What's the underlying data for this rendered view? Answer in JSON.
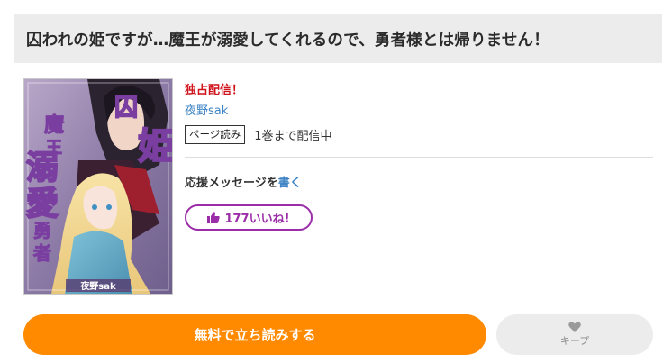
{
  "title": "囚われの姫ですが…魔王が溺愛してくれるので、勇者様とは帰りません！",
  "cover": {
    "title_text": "囚われの姫ですが…魔王が溺愛してくれるので、勇者様とは帰りません！",
    "author_credit": "夜野sak"
  },
  "info": {
    "exclusive_label": "独占配信！",
    "author": "夜野sak",
    "format_tag": "ページ読み",
    "availability": "1巻まで配信中",
    "cheer_text": "応援メッセージを",
    "cheer_link": "書く",
    "like_count": "177いいね!"
  },
  "actions": {
    "read_free": "無料で立ち読みする",
    "keep": "キープ"
  },
  "colors": {
    "accent_orange": "#ff8a00",
    "like_purple": "#9b2ea8",
    "exclusive_red": "#d0121b",
    "link_blue": "#3f84c4"
  },
  "icons": {
    "like": "thumbs-up-icon",
    "keep": "heart-icon"
  }
}
